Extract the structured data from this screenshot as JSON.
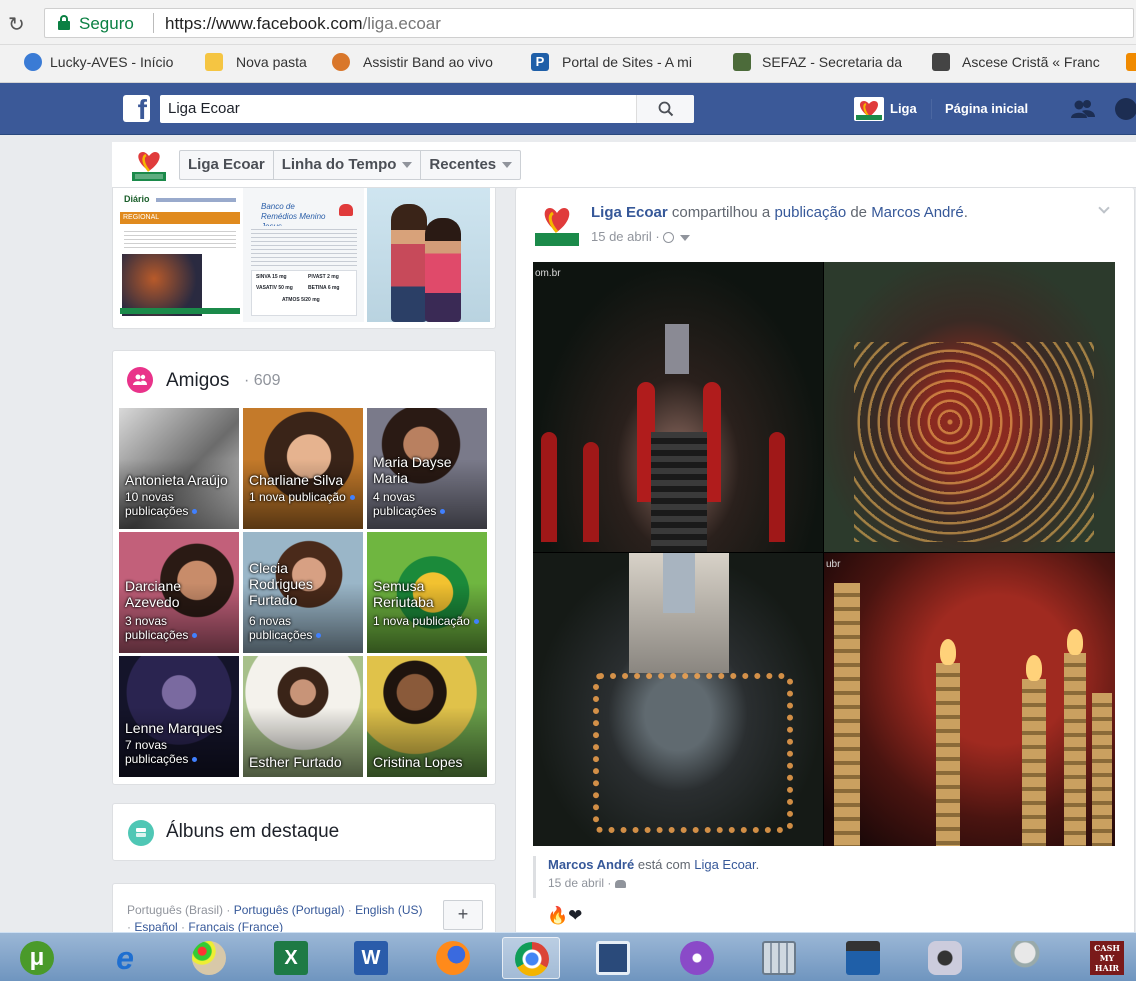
{
  "browser": {
    "secure_label": "Seguro",
    "url_host": "https://www.facebook.com",
    "url_path": "/liga.ecoar",
    "bookmarks": [
      {
        "label": "Lucky-AVES - Início",
        "icon": "globe-icon",
        "color": "#3a7bd5"
      },
      {
        "label": "Nova pasta",
        "icon": "folder-icon",
        "color": "#f5c542"
      },
      {
        "label": "Assistir Band ao vivo",
        "icon": "tv-icon",
        "color": "#d9772b"
      },
      {
        "label": "Portal de Sites - A mi",
        "icon": "p-icon",
        "color": "#1f5fa8"
      },
      {
        "label": "SEFAZ - Secretaria da",
        "icon": "shield-icon",
        "color": "#4c6b3a"
      },
      {
        "label": "Ascese Cristã « Franc",
        "icon": "church-icon",
        "color": "#444444"
      }
    ]
  },
  "fb": {
    "search_value": "Liga Ecoar",
    "profile_name": "Liga",
    "home_label": "Página inicial",
    "brand_color": "#3b5998"
  },
  "pagenav": {
    "page_name": "Liga Ecoar",
    "timeline_label": "Linha do Tempo",
    "recent_label": "Recentes"
  },
  "photos": {
    "doc1_header": "Diário",
    "doc1_band": "REGIONAL",
    "doc2_title": "Banco de Remédios Menino Jesus",
    "doc2_meds": [
      "SINVA 15 mg",
      "PIVAST 2 mg",
      "VASATIV 50 mg",
      "BETINA 6 mg",
      "ATMOS 5/20 mg"
    ]
  },
  "friends": {
    "title": "Amigos",
    "count": "· 609",
    "list": [
      {
        "name": "Antonieta Araújo",
        "news": "10 novas publicações"
      },
      {
        "name": "Charliane Silva",
        "news": "1 nova publicação"
      },
      {
        "name": "Maria Dayse Maria",
        "news": "4 novas publicações"
      },
      {
        "name": "Darciane Azevedo",
        "news": "3 novas publicações"
      },
      {
        "name": "Clecia Rodrigues Furtado",
        "news": "6 novas publicações"
      },
      {
        "name": "Semusa Reriutaba",
        "news": "1 nova publicação"
      },
      {
        "name": "Lenne Marques",
        "news": "7 novas publicações"
      },
      {
        "name": "Esther Furtado",
        "news": ""
      },
      {
        "name": "Cristina Lopes",
        "news": ""
      }
    ]
  },
  "albums": {
    "title": "Álbuns em destaque"
  },
  "languages": {
    "current": "Português (Brasil)",
    "others": [
      "Português (Portugal)",
      "English (US)",
      "Español",
      "Français (France)"
    ],
    "plus": "+"
  },
  "post": {
    "author": "Liga Ecoar",
    "action_1": "compartilhou a",
    "action_link": "publicação",
    "action_2": "de",
    "source": "Marcos André",
    "date": "15 de abril",
    "photo_watermark_1": "om.br",
    "photo_watermark_2": "ubr",
    "caption_author": "Marcos André",
    "caption_action": "está com",
    "caption_page": "Liga Ecoar",
    "caption_date": "15 de abril",
    "reactions": "🔥❤"
  },
  "taskbar": {
    "apps": [
      "utorrent-icon",
      "internet-explorer-icon",
      "paint-icon",
      "excel-icon",
      "word-icon",
      "firefox-icon",
      "chrome-icon",
      "film-icon",
      "media-center-icon",
      "calculator-icon",
      "movie-maker-icon",
      "camera-icon",
      "robot-icon",
      "cash-my-hair-icon"
    ],
    "cash_label": "CASH MY HAIR"
  }
}
